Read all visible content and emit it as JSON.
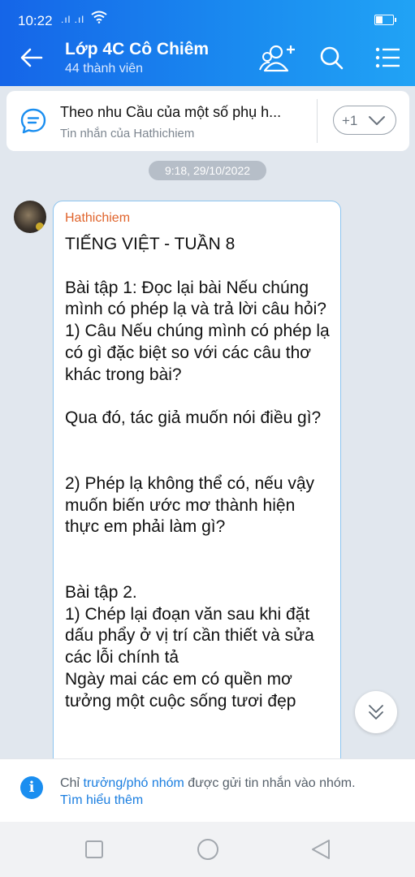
{
  "status": {
    "time": "10:22",
    "signal": ".ıl .ıl"
  },
  "header": {
    "title": "Lớp 4C Cô Chiêm",
    "subtitle": "44 thành viên"
  },
  "pinned": {
    "title": "Theo nhu Cầu của một số phụ h...",
    "subtitle": "Tin nhắn của Hathichiem",
    "more_label": "+1"
  },
  "timestamp": "9:18, 29/10/2022",
  "message": {
    "sender": "Hathichiem",
    "text": "TIẾNG VIỆT - TUẦN 8\n\nBài tập 1: Đọc lại bài Nếu chúng mình có phép lạ và trả lời câu hỏi?\n1) Câu Nếu chúng mình có phép lạ có gì đặc biệt so với các câu thơ khác trong bài?\n\nQua đó, tác giả muốn nói điều gì?\n\n\n2) Phép lạ không thể có, nếu vậy muốn biến ước mơ thành hiện thực em phải làm gì?\n\n\nBài tập 2.\n1) Chép lại đoạn văn sau khi đặt dấu phẩy ở vị trí cần thiết và sửa các lỗi chính tả\nNgày mai các em có quền mơ tưởng một cuộc sống tươi đẹp"
  },
  "notice": {
    "prefix": "Chỉ ",
    "link": "trưởng/phó nhóm",
    "suffix": " được gửi tin nhắn vào nhóm.",
    "learn_more": "Tìm hiểu thêm",
    "info_glyph": "i"
  },
  "icons": [
    "back-arrow-icon",
    "add-member-icon",
    "search-icon",
    "menu-list-icon",
    "chat-bubble-icon",
    "chevron-down-icon",
    "info-icon",
    "square-nav-icon",
    "circle-nav-icon",
    "triangle-nav-icon"
  ],
  "colors": {
    "header_start": "#1565e8",
    "header_end": "#21a3f5",
    "sender": "#e0642c",
    "link": "#1a7ee0",
    "bubble_border": "#8cc4ef"
  }
}
